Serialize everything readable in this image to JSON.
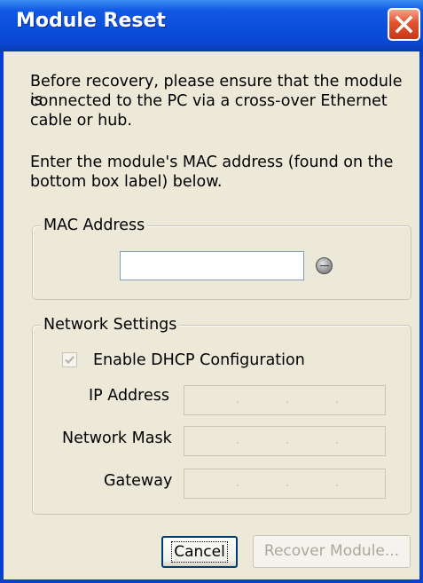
{
  "window": {
    "title": "Module Reset"
  },
  "instructions": {
    "line1": "Before recovery, please ensure that the module is",
    "line2": "connected to the PC via a cross-over Ethernet",
    "line3": "cable or hub.",
    "line4": "Enter the module's MAC address (found on the",
    "line5": "bottom box label) below."
  },
  "mac_group": {
    "label": "MAC Address",
    "value": ""
  },
  "network_group": {
    "label": "Network Settings",
    "dhcp_label": "Enable DHCP Configuration",
    "dhcp_checked": true,
    "ip_label": "IP Address",
    "mask_label": "Network Mask",
    "gateway_label": "Gateway",
    "ip_dots": ".",
    "mask_dots": ".",
    "gateway_dots": "."
  },
  "buttons": {
    "cancel": "Cancel",
    "recover": "Recover Module..."
  },
  "colors": {
    "title_bar": "#0a4fdc",
    "close_button": "#e2532e",
    "dialog_bg": "#ece9d8"
  }
}
